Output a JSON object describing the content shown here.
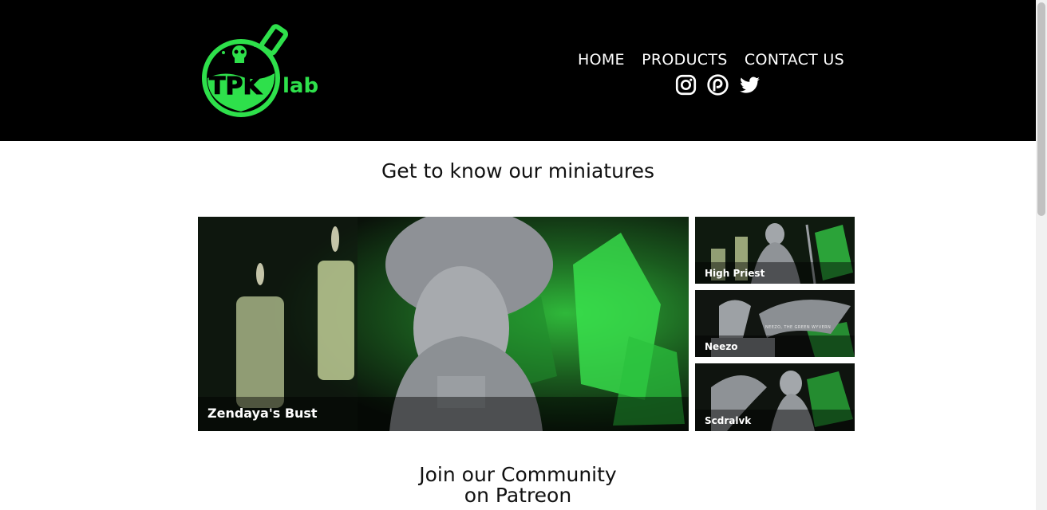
{
  "brand": {
    "logo_text_main": "TPK",
    "logo_text_secondary": "lab",
    "accent_color": "#2ee04b"
  },
  "nav": {
    "items": [
      {
        "label": "HOME"
      },
      {
        "label": "PRODUCTS"
      },
      {
        "label": "CONTACT US"
      }
    ]
  },
  "social": {
    "icons": [
      "instagram-icon",
      "patreon-icon",
      "twitter-icon"
    ]
  },
  "gallery": {
    "title": "Get to know our miniatures",
    "featured": {
      "label": "Zendaya's Bust"
    },
    "items": [
      {
        "label": "High Priest"
      },
      {
        "label": "Neezo",
        "inner_text": "NEEZO, THE GREEN WYVERN"
      },
      {
        "label": "Scdralvk"
      }
    ]
  },
  "community": {
    "title_line1": "Join our Community",
    "title_line2": "on Patreon"
  }
}
